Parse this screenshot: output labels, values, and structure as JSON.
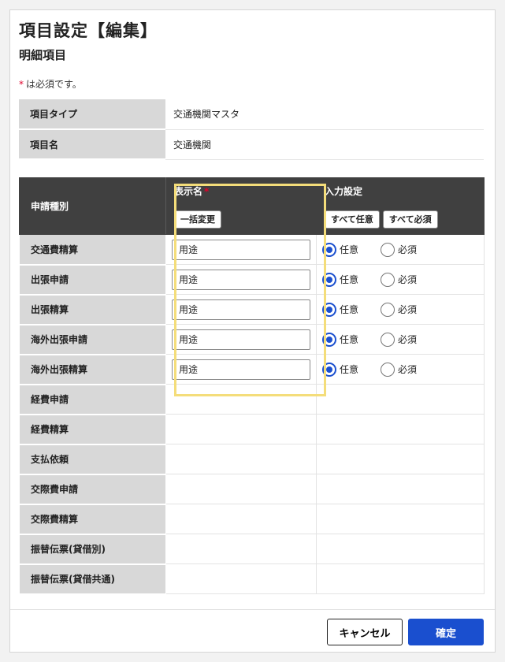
{
  "dialog": {
    "title": "項目設定【編集】",
    "section_title": "明細項目",
    "required_star": "*",
    "required_note": "は必須です。"
  },
  "info": [
    {
      "label": "項目タイプ",
      "value": "交通機関マスタ"
    },
    {
      "label": "項目名",
      "value": "交通機関"
    }
  ],
  "grid": {
    "col_kind": "申請種別",
    "col_display": "表示名",
    "col_display_star": "*",
    "col_input": "入力設定",
    "btn_bulk": "一括変更",
    "btn_all_optional": "すべて任意",
    "btn_all_required": "すべて必須",
    "opt_optional": "任意",
    "opt_required": "必須",
    "rows": [
      {
        "kind": "交通費精算",
        "display": "用途",
        "setting": "任意"
      },
      {
        "kind": "出張申請",
        "display": "用途",
        "setting": "任意"
      },
      {
        "kind": "出張精算",
        "display": "用途",
        "setting": "任意"
      },
      {
        "kind": "海外出張申請",
        "display": "用途",
        "setting": "任意"
      },
      {
        "kind": "海外出張精算",
        "display": "用途",
        "setting": "任意"
      },
      {
        "kind": "経費申請"
      },
      {
        "kind": "経費精算"
      },
      {
        "kind": "支払依頼"
      },
      {
        "kind": "交際費申請"
      },
      {
        "kind": "交際費精算"
      },
      {
        "kind": "振替伝票(貸借別)"
      },
      {
        "kind": "振替伝票(貸借共通)"
      }
    ]
  },
  "footer": {
    "cancel_label": "キャンセル",
    "ok_label": "確定"
  },
  "colors": {
    "header_bg": "#404040",
    "label_bg": "#d8d8d8",
    "accent": "#1a4fcf",
    "required": "#e0002a",
    "highlight": "#f4dd7a"
  }
}
